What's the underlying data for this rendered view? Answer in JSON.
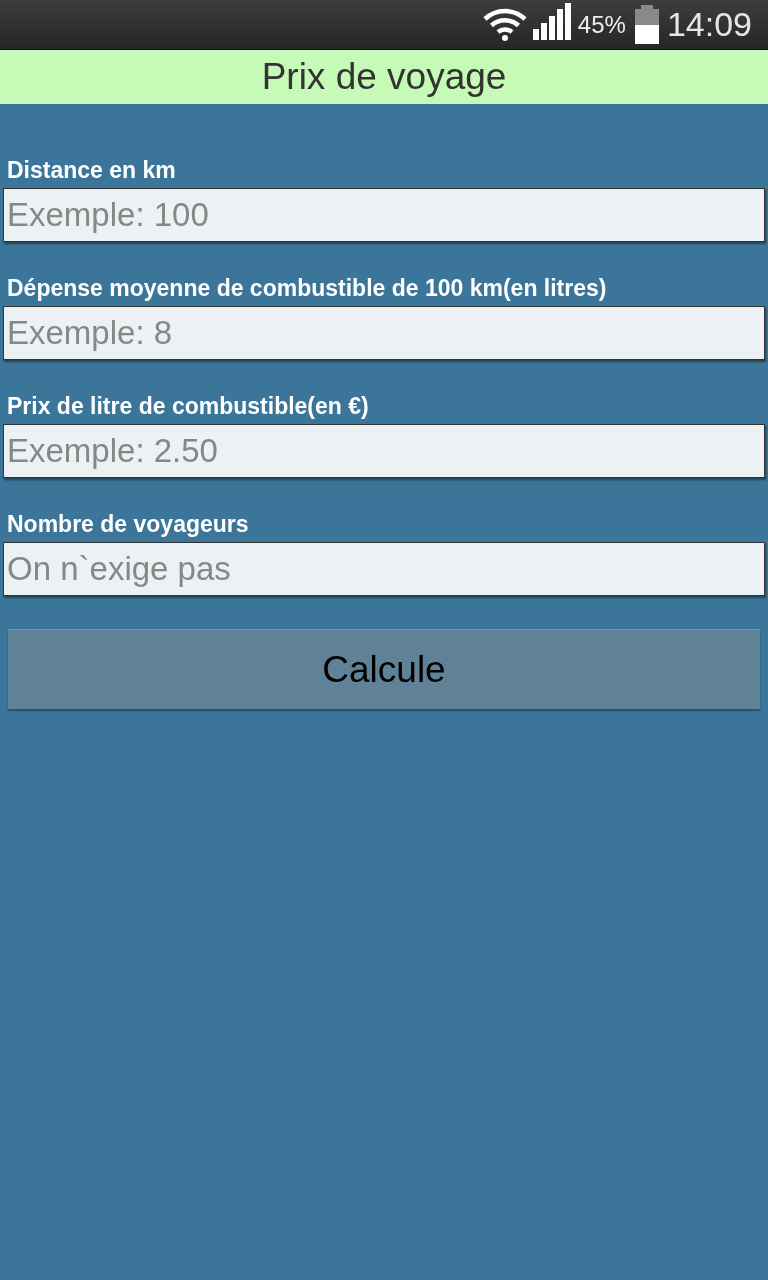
{
  "status_bar": {
    "battery_percent": "45%",
    "time": "14:09"
  },
  "title_bar": {
    "title": "Prix de voyage"
  },
  "form": {
    "fields": [
      {
        "label": "Distance en km",
        "placeholder": "Exemple: 100"
      },
      {
        "label": "Dépense moyenne de combustible de 100 km(en litres)",
        "placeholder": "Exemple: 8"
      },
      {
        "label": "Prix de litre de combustible(en €)",
        "placeholder": "Exemple: 2.50"
      },
      {
        "label": "Nombre de voyageurs",
        "placeholder": "On n`exige pas"
      }
    ]
  },
  "calculate_button": {
    "label": "Calcule"
  }
}
